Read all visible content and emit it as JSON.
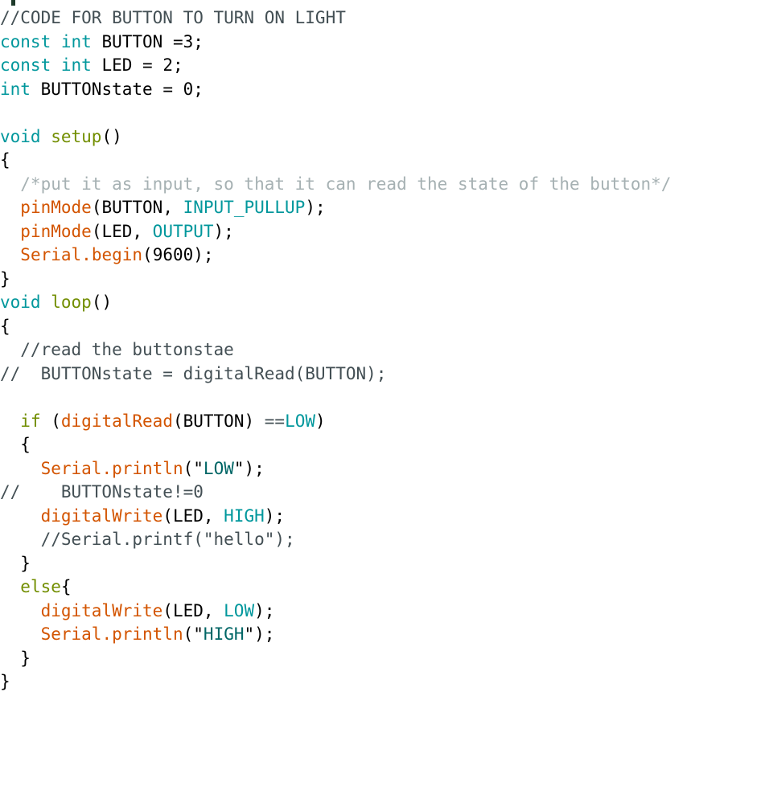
{
  "app": {
    "name": "arduino-code-editor",
    "language": "C++ (Arduino)",
    "background_color": "#ffffff"
  },
  "theme": {
    "keyword_color": "#00979c",
    "function_name_color": "#728e00",
    "builtin_function_color": "#d35400",
    "constant_color": "#00979c",
    "string_color": "#006666",
    "line_comment_color": "#434f54",
    "block_comment_color": "#a6b1b3",
    "operator_color": "#434f54",
    "plain_text_color": "#000000"
  },
  "code": {
    "lines": [
      {
        "index": 1,
        "tokens": [
          {
            "t": "//CODE FOR BUTTON TO TURN ON LIGHT",
            "c": "comment"
          }
        ]
      },
      {
        "index": 2,
        "tokens": [
          {
            "t": "const",
            "c": "kw"
          },
          {
            "t": " ",
            "c": "plain"
          },
          {
            "t": "int",
            "c": "kw"
          },
          {
            "t": " BUTTON ",
            "c": "plain"
          },
          {
            "t": "=",
            "c": "plain"
          },
          {
            "t": "3",
            "c": "num"
          },
          {
            "t": ";",
            "c": "punc"
          }
        ]
      },
      {
        "index": 3,
        "tokens": [
          {
            "t": "const",
            "c": "kw"
          },
          {
            "t": " ",
            "c": "plain"
          },
          {
            "t": "int",
            "c": "kw"
          },
          {
            "t": " LED ",
            "c": "plain"
          },
          {
            "t": "=",
            "c": "plain"
          },
          {
            "t": " ",
            "c": "plain"
          },
          {
            "t": "2",
            "c": "num"
          },
          {
            "t": ";",
            "c": "punc"
          }
        ]
      },
      {
        "index": 4,
        "tokens": [
          {
            "t": "int",
            "c": "kw"
          },
          {
            "t": " BUTTONstate ",
            "c": "plain"
          },
          {
            "t": "=",
            "c": "plain"
          },
          {
            "t": " ",
            "c": "plain"
          },
          {
            "t": "0",
            "c": "num"
          },
          {
            "t": ";",
            "c": "punc"
          }
        ]
      },
      {
        "index": 5,
        "tokens": []
      },
      {
        "index": 6,
        "tokens": [
          {
            "t": "void",
            "c": "kw"
          },
          {
            "t": " ",
            "c": "plain"
          },
          {
            "t": "setup",
            "c": "fnname"
          },
          {
            "t": "()",
            "c": "punc"
          }
        ]
      },
      {
        "index": 7,
        "tokens": [
          {
            "t": "{",
            "c": "punc"
          }
        ]
      },
      {
        "index": 8,
        "tokens": [
          {
            "t": "  /*put it as input, so that it can read the state of the button*/",
            "c": "blockc"
          }
        ]
      },
      {
        "index": 9,
        "tokens": [
          {
            "t": "  ",
            "c": "plain"
          },
          {
            "t": "pinMode",
            "c": "func"
          },
          {
            "t": "(BUTTON, ",
            "c": "punc"
          },
          {
            "t": "INPUT_PULLUP",
            "c": "const"
          },
          {
            "t": ");",
            "c": "punc"
          }
        ]
      },
      {
        "index": 10,
        "tokens": [
          {
            "t": "  ",
            "c": "plain"
          },
          {
            "t": "pinMode",
            "c": "func"
          },
          {
            "t": "(LED, ",
            "c": "punc"
          },
          {
            "t": "OUTPUT",
            "c": "const"
          },
          {
            "t": ");",
            "c": "punc"
          }
        ]
      },
      {
        "index": 11,
        "tokens": [
          {
            "t": "  ",
            "c": "plain"
          },
          {
            "t": "Serial",
            "c": "func"
          },
          {
            "t": ".",
            "c": "func"
          },
          {
            "t": "begin",
            "c": "func"
          },
          {
            "t": "(",
            "c": "punc"
          },
          {
            "t": "9600",
            "c": "num"
          },
          {
            "t": ");",
            "c": "punc"
          }
        ]
      },
      {
        "index": 12,
        "tokens": [
          {
            "t": "}",
            "c": "punc"
          }
        ]
      },
      {
        "index": 13,
        "tokens": [
          {
            "t": "void",
            "c": "kw"
          },
          {
            "t": " ",
            "c": "plain"
          },
          {
            "t": "loop",
            "c": "fnname"
          },
          {
            "t": "()",
            "c": "punc"
          }
        ]
      },
      {
        "index": 14,
        "tokens": [
          {
            "t": "{",
            "c": "punc"
          }
        ]
      },
      {
        "index": 15,
        "tokens": [
          {
            "t": "  //read the buttonstae",
            "c": "comment"
          }
        ]
      },
      {
        "index": 16,
        "tokens": [
          {
            "t": "//  BUTTONstate = digitalRead(BUTTON);",
            "c": "comment"
          }
        ]
      },
      {
        "index": 17,
        "tokens": []
      },
      {
        "index": 18,
        "tokens": [
          {
            "t": "  ",
            "c": "plain"
          },
          {
            "t": "if",
            "c": "fnname"
          },
          {
            "t": " (",
            "c": "punc"
          },
          {
            "t": "digitalRead",
            "c": "func"
          },
          {
            "t": "(BUTTON) ",
            "c": "punc"
          },
          {
            "t": "==",
            "c": "op"
          },
          {
            "t": "LOW",
            "c": "const"
          },
          {
            "t": ")",
            "c": "punc"
          }
        ]
      },
      {
        "index": 19,
        "tokens": [
          {
            "t": "  {",
            "c": "punc"
          }
        ]
      },
      {
        "index": 20,
        "tokens": [
          {
            "t": "    ",
            "c": "plain"
          },
          {
            "t": "Serial",
            "c": "func"
          },
          {
            "t": ".",
            "c": "func"
          },
          {
            "t": "println",
            "c": "func"
          },
          {
            "t": "(",
            "c": "punc"
          },
          {
            "t": "\"",
            "c": "quote"
          },
          {
            "t": "LOW",
            "c": "string"
          },
          {
            "t": "\"",
            "c": "quote"
          },
          {
            "t": ");",
            "c": "punc"
          }
        ]
      },
      {
        "index": 21,
        "tokens": [
          {
            "t": "//    BUTTONstate!=0",
            "c": "comment"
          }
        ]
      },
      {
        "index": 22,
        "tokens": [
          {
            "t": "    ",
            "c": "plain"
          },
          {
            "t": "digitalWrite",
            "c": "func"
          },
          {
            "t": "(LED, ",
            "c": "punc"
          },
          {
            "t": "HIGH",
            "c": "const"
          },
          {
            "t": ");",
            "c": "punc"
          }
        ]
      },
      {
        "index": 23,
        "tokens": [
          {
            "t": "    //Serial.printf(\"hello\");",
            "c": "comment"
          }
        ]
      },
      {
        "index": 24,
        "tokens": [
          {
            "t": "  }",
            "c": "punc"
          }
        ]
      },
      {
        "index": 25,
        "tokens": [
          {
            "t": "  ",
            "c": "plain"
          },
          {
            "t": "else",
            "c": "fnname"
          },
          {
            "t": "{",
            "c": "punc"
          }
        ]
      },
      {
        "index": 26,
        "tokens": [
          {
            "t": "    ",
            "c": "plain"
          },
          {
            "t": "digitalWrite",
            "c": "func"
          },
          {
            "t": "(LED, ",
            "c": "punc"
          },
          {
            "t": "LOW",
            "c": "const"
          },
          {
            "t": ");",
            "c": "punc"
          }
        ]
      },
      {
        "index": 27,
        "tokens": [
          {
            "t": "    ",
            "c": "plain"
          },
          {
            "t": "Serial",
            "c": "func"
          },
          {
            "t": ".",
            "c": "func"
          },
          {
            "t": "println",
            "c": "func"
          },
          {
            "t": "(",
            "c": "punc"
          },
          {
            "t": "\"",
            "c": "quote"
          },
          {
            "t": "HIGH",
            "c": "string"
          },
          {
            "t": "\"",
            "c": "quote"
          },
          {
            "t": ");",
            "c": "punc"
          }
        ]
      },
      {
        "index": 28,
        "tokens": [
          {
            "t": "  }",
            "c": "punc"
          }
        ]
      },
      {
        "index": 29,
        "tokens": [
          {
            "t": "}",
            "c": "punc"
          }
        ]
      }
    ],
    "plain_text": "//CODE FOR BUTTON TO TURN ON LIGHT\nconst int BUTTON =3;\nconst int LED = 2;\nint BUTTONstate = 0;\n\nvoid setup()\n{\n  /*put it as input, so that it can read the state of the button*/\n  pinMode(BUTTON, INPUT_PULLUP);\n  pinMode(LED, OUTPUT);\n  Serial.begin(9600);\n}\nvoid loop()\n{\n  //read the buttonstae\n//  BUTTONstate = digitalRead(BUTTON);\n\n  if (digitalRead(BUTTON) ==LOW)\n  {\n    Serial.println(\"LOW\");\n//    BUTTONstate!=0\n    digitalWrite(LED, HIGH);\n    //Serial.printf(\"hello\");\n  }\n  else{\n    digitalWrite(LED, LOW);\n    Serial.println(\"HIGH\");\n  }\n}"
  }
}
